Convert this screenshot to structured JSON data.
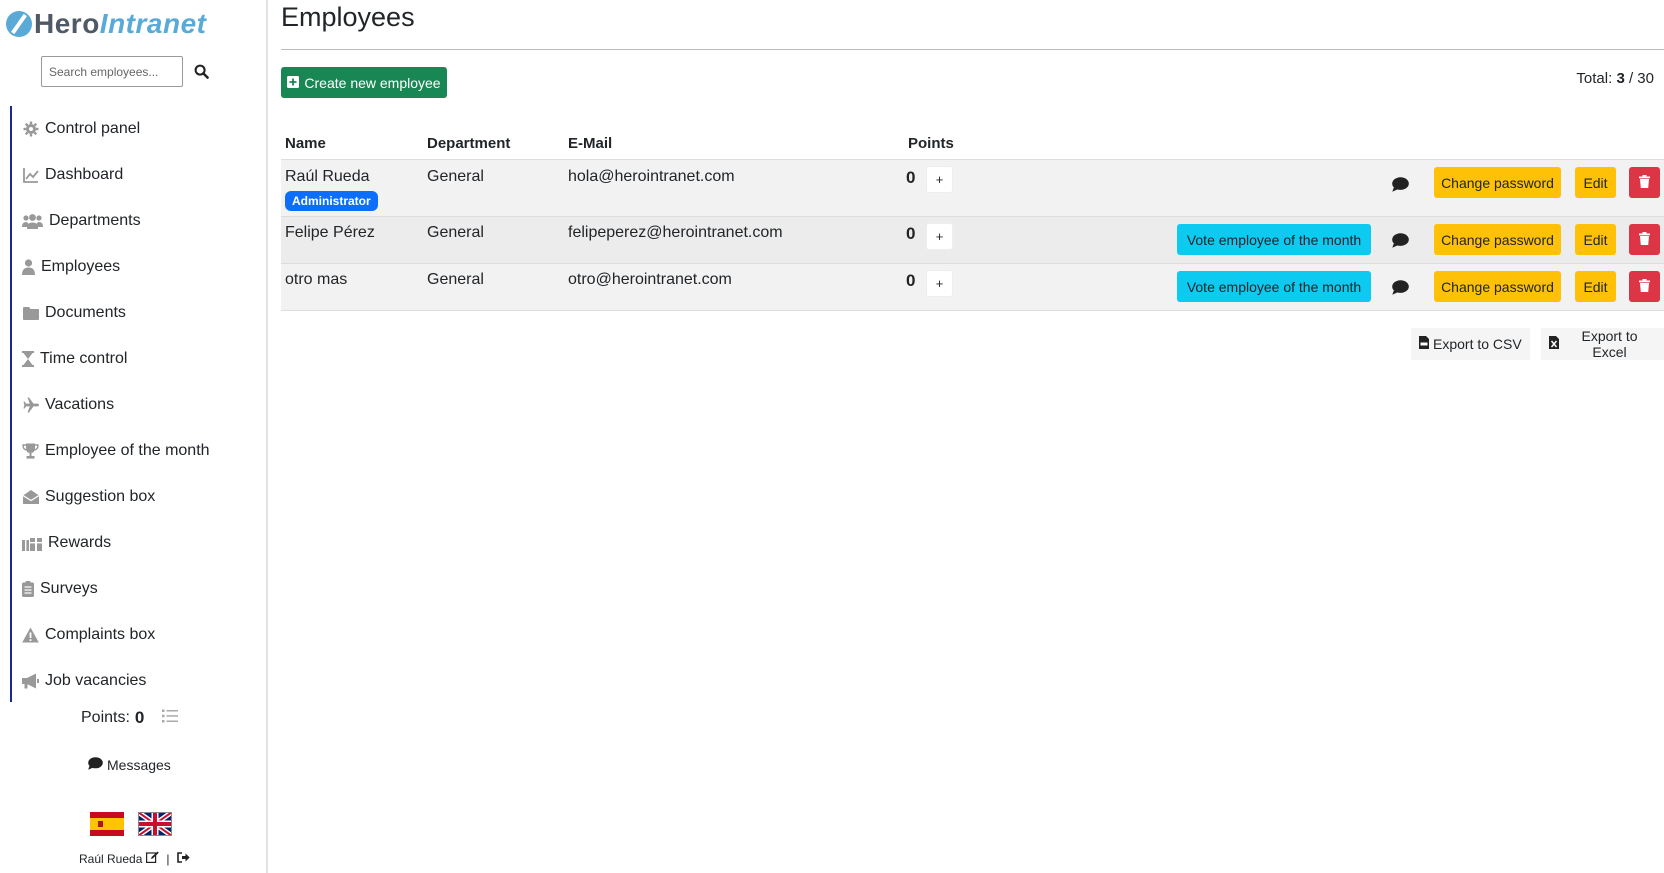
{
  "app": {
    "logo_part1": "Hero",
    "logo_part2": "Intranet"
  },
  "search": {
    "placeholder": "Search employees..."
  },
  "nav": {
    "items": [
      {
        "label": "Control panel",
        "icon": "gear-icon"
      },
      {
        "label": "Dashboard",
        "icon": "chart-line-icon"
      },
      {
        "label": "Departments",
        "icon": "users-icon"
      },
      {
        "label": "Employees",
        "icon": "user-icon"
      },
      {
        "label": "Documents",
        "icon": "folder-icon"
      },
      {
        "label": "Time control",
        "icon": "hourglass-icon"
      },
      {
        "label": "Vacations",
        "icon": "plane-icon"
      },
      {
        "label": "Employee of the month",
        "icon": "trophy-icon"
      },
      {
        "label": "Suggestion box",
        "icon": "envelope-open-icon"
      },
      {
        "label": "Rewards",
        "icon": "gifts-icon"
      },
      {
        "label": "Surveys",
        "icon": "clipboard-icon"
      },
      {
        "label": "Complaints box",
        "icon": "warning-icon"
      },
      {
        "label": "Job vacancies",
        "icon": "megaphone-icon"
      }
    ]
  },
  "sidebar": {
    "points_label": "Points:",
    "points_value": "0",
    "messages_label": "Messages",
    "user_name": "Raúl Rueda",
    "separator": "|"
  },
  "page": {
    "title": "Employees",
    "create_button": "Create new employee",
    "total_label": "Total:",
    "total_shown": "3",
    "total_sep": "/ 30"
  },
  "table": {
    "headers": {
      "name": "Name",
      "department": "Department",
      "email": "E-Mail",
      "points": "Points"
    },
    "rows": [
      {
        "name": "Raúl Rueda",
        "badge": "Administrator",
        "department": "General",
        "email": "hola@herointranet.com",
        "points": "0"
      },
      {
        "name": "Felipe Pérez",
        "department": "General",
        "email": "felipeperez@herointranet.com",
        "points": "0"
      },
      {
        "name": "otro mas",
        "department": "General",
        "email": "otro@herointranet.com",
        "points": "0"
      }
    ],
    "actions": {
      "plus": "+",
      "vote": "Vote employee of the month",
      "change_password": "Change password",
      "edit": "Edit"
    }
  },
  "export": {
    "csv": "Export to CSV",
    "excel": "Export to Excel"
  },
  "colors": {
    "create": "#198754",
    "vote": "#0dcaf0",
    "warning": "#ffc107",
    "danger": "#dc3545",
    "badge": "#0d6efd",
    "nav_border": "#1b2a8f",
    "logo_blue": "#5aaad8"
  }
}
